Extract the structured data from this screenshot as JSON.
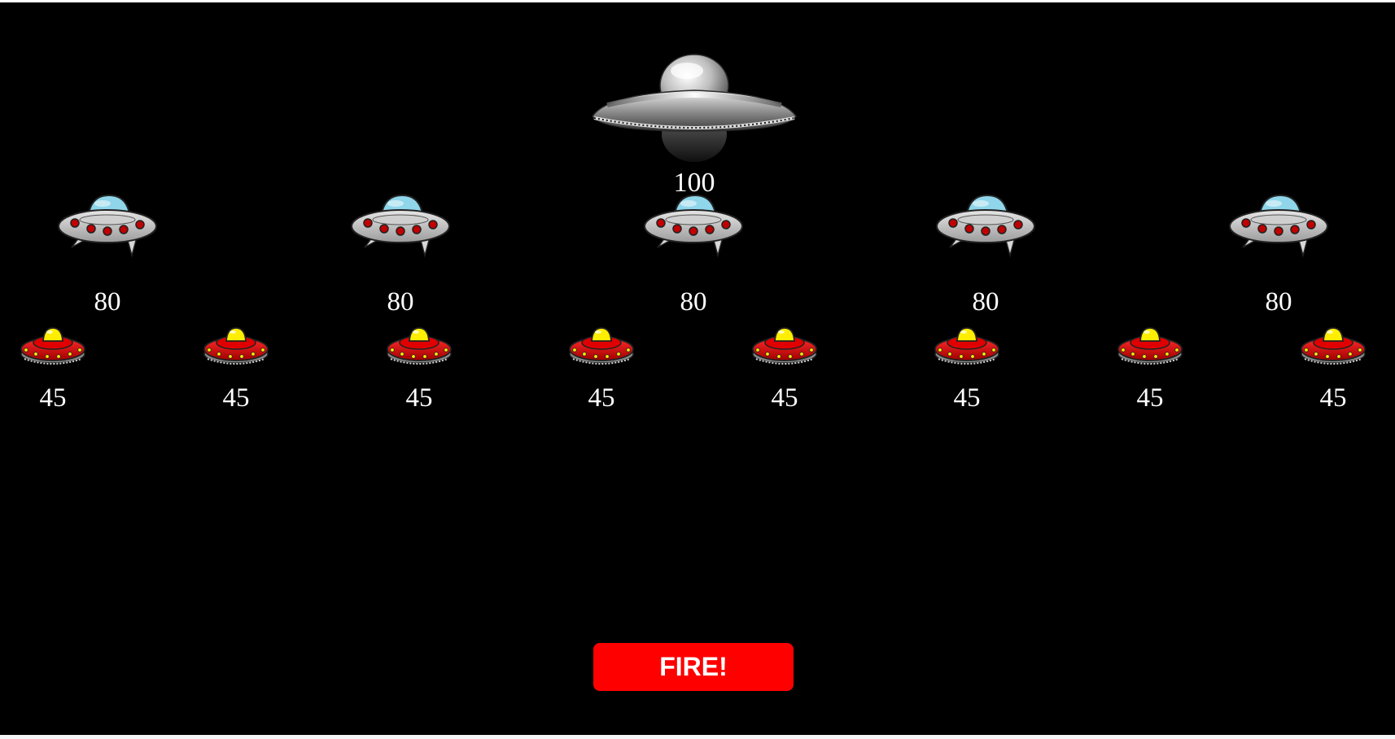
{
  "game": {
    "boss": {
      "icon": "silver-mothership-icon",
      "points": "100"
    },
    "mid_row": {
      "icon": "blue-dome-ufo-icon",
      "ships": [
        {
          "points": "80"
        },
        {
          "points": "80"
        },
        {
          "points": "80"
        },
        {
          "points": "80"
        },
        {
          "points": "80"
        }
      ]
    },
    "small_row": {
      "icon": "red-yellow-saucer-icon",
      "ships": [
        {
          "points": "45"
        },
        {
          "points": "45"
        },
        {
          "points": "45"
        },
        {
          "points": "45"
        },
        {
          "points": "45"
        },
        {
          "points": "45"
        },
        {
          "points": "45"
        },
        {
          "points": "45"
        }
      ]
    },
    "fire_button": {
      "label": "FIRE!"
    }
  },
  "colors": {
    "background": "#000000",
    "fire_button": "#ff0000",
    "text": "#ffffff",
    "blue_dome": "#8fd6ea",
    "red_saucer": "#e00000",
    "yellow_dome": "#ffee00"
  }
}
